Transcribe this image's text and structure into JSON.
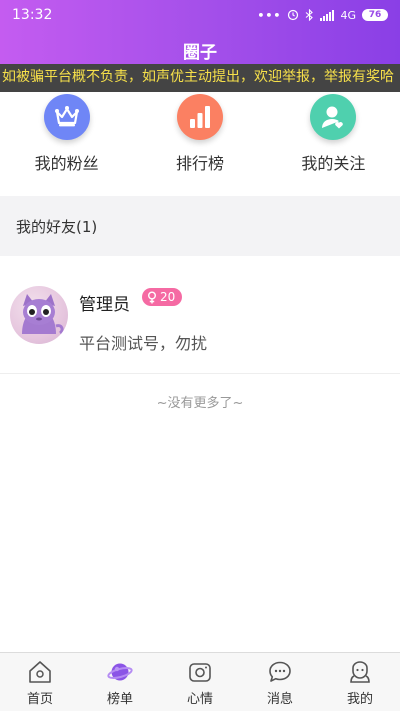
{
  "status_bar": {
    "time": "13:32",
    "network": "4G",
    "battery": "76"
  },
  "header": {
    "title": "圈子"
  },
  "notice": {
    "text": "如被骗平台概不负责，如声优主动提出，欢迎举报，举报有奖哈"
  },
  "quick_links": [
    {
      "label": "我的粉丝",
      "icon": "crown-icon",
      "color": "#6f86f6"
    },
    {
      "label": "排行榜",
      "icon": "bar-chart-icon",
      "color": "#fb8062"
    },
    {
      "label": "我的关注",
      "icon": "user-heart-icon",
      "color": "#4fd0ae"
    }
  ],
  "friends_section": {
    "title": "我的好友(1)"
  },
  "friends": [
    {
      "name": "管理员",
      "badge_value": "20",
      "badge_icon": "female-icon",
      "signature": "平台测试号，勿扰"
    }
  ],
  "list_footer": "~没有更多了~",
  "tabs": [
    {
      "label": "首页",
      "icon": "home-icon"
    },
    {
      "label": "榜单",
      "icon": "planet-icon"
    },
    {
      "label": "心情",
      "icon": "camera-icon"
    },
    {
      "label": "消息",
      "icon": "chat-icon"
    },
    {
      "label": "我的",
      "icon": "profile-icon"
    }
  ],
  "colors": {
    "header_start": "#c45cf0",
    "header_end": "#8a3fe6",
    "notice_text": "#f6e04a",
    "badge": "#f56aa3"
  }
}
